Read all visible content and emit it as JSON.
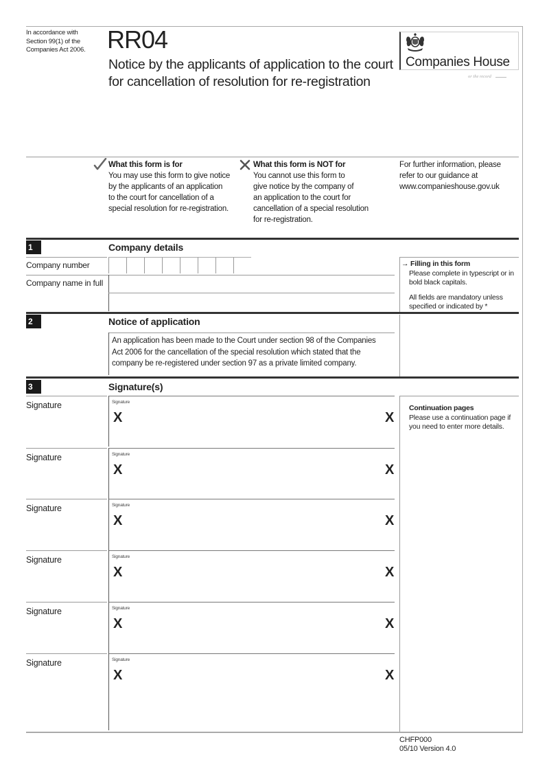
{
  "header": {
    "legal_reference": [
      "In accordance with",
      "Section 99(1) of the",
      "Companies Act 2006."
    ],
    "form_code": "RR04",
    "form_title_lines": [
      "Notice by the applicants of application to the court",
      "for cancellation of resolution for re-registration"
    ],
    "logo": {
      "crest_icon": "royal-coat-of-arms-icon",
      "name": "Companies House",
      "tagline": "or the record"
    }
  },
  "purpose": {
    "is_for": {
      "icon": "check-icon",
      "heading": "What this form is for",
      "lines": [
        "You may use this form to give notice",
        "by the applicants of an application",
        "to the court for cancellation of a",
        "special resolution for re-registration."
      ]
    },
    "not_for": {
      "icon": "cross-icon",
      "heading": "What this form is NOT for",
      "lines": [
        "You cannot use this form to",
        "give notice by the company of",
        "an application to the court for",
        "cancellation of a special resolution",
        "for re-registration."
      ]
    },
    "further_info": {
      "lines": [
        "For further information, please",
        "refer to our guidance at",
        "www.companieshouse.gov.uk"
      ]
    }
  },
  "sections": {
    "s1": {
      "number": "1",
      "title": "Company details",
      "company_number_label": "Company number",
      "company_number_value": "",
      "company_number_digits": 8,
      "company_name_label": "Company name in full",
      "company_name_line1": "",
      "company_name_line2": "",
      "side_note": {
        "icon": "arrow-right-icon",
        "heading": "Filling in this form",
        "text": [
          "Please complete in typescript or in",
          "bold black capitals."
        ],
        "text2": [
          "All fields are mandatory unless",
          "specified or indicated by *"
        ]
      }
    },
    "s2": {
      "number": "2",
      "title": "Notice of application",
      "text_lines": [
        "An application has been made to the Court under section 98 of the Companies",
        "Act 2006 for the cancellation of the special resolution which stated that the",
        "company be re-registered under section 97 as a private limited company."
      ]
    },
    "s3": {
      "number": "3",
      "title": "Signature(s)",
      "signatures": [
        {
          "label": "Signature",
          "box_label": "Signature",
          "mark": "X"
        },
        {
          "label": "Signature",
          "box_label": "Signature",
          "mark": "X"
        },
        {
          "label": "Signature",
          "box_label": "Signature",
          "mark": "X"
        },
        {
          "label": "Signature",
          "box_label": "Signature",
          "mark": "X"
        },
        {
          "label": "Signature",
          "box_label": "Signature",
          "mark": "X"
        },
        {
          "label": "Signature",
          "box_label": "Signature",
          "mark": "X"
        }
      ],
      "side_note": {
        "heading": "Continuation pages",
        "text": [
          "Please use a continuation page if",
          "you need to enter more details."
        ]
      }
    }
  },
  "footer": {
    "code": "CHFP000",
    "version": "05/10 Version 4.0"
  }
}
